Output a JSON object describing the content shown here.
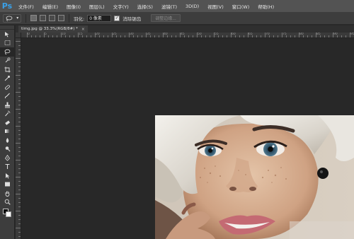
{
  "app": {
    "logo": "Ps",
    "menu": [
      "文件(F)",
      "编辑(E)",
      "图像(I)",
      "图层(L)",
      "文字(Y)",
      "选择(S)",
      "滤镜(T)",
      "3D(D)",
      "视图(V)",
      "窗口(W)",
      "帮助(H)"
    ]
  },
  "options": {
    "feather_label": "羽化:",
    "feather_value": "0 像素",
    "antialias_label": "消除锯齿",
    "antialias_checked": true,
    "refine_label": "调整边缘..."
  },
  "document": {
    "tab_title": "timg.jpg @ 33.3%(RGB/8#) *",
    "close_symbol": "×"
  },
  "ruler": {
    "h_labels": [
      "0",
      "5",
      "10",
      "15",
      "20",
      "25",
      "30",
      "35",
      "40",
      "45",
      "50",
      "55",
      "60",
      "65",
      "70",
      "75",
      "80",
      "85",
      "90",
      "95"
    ]
  },
  "tools": [
    "move-icon",
    "marquee-icon",
    "lasso-icon",
    "quick-select-icon",
    "crop-icon",
    "eyedropper-icon",
    "healing-icon",
    "brush-icon",
    "stamp-icon",
    "history-brush-icon",
    "eraser-icon",
    "gradient-icon",
    "blur-icon",
    "dodge-icon",
    "pen-icon",
    "type-icon",
    "path-select-icon",
    "shape-icon",
    "hand-icon",
    "zoom-icon"
  ],
  "colors": {
    "accent": "#3aa0e8",
    "canvas_bg": "#282828",
    "panel_bg": "#3d3d3d",
    "menubar_bg": "#535353"
  }
}
